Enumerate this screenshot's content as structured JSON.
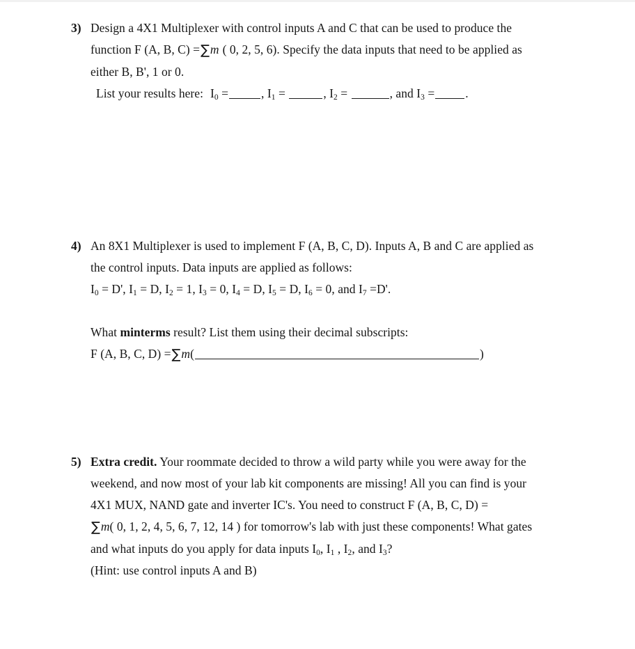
{
  "document": {
    "type": "homework-worksheet",
    "subject": "Digital Logic - Multiplexers",
    "background_color": "#ffffff",
    "text_color": "#161616"
  },
  "questions": [
    {
      "number": "3)",
      "name": "question-3",
      "lines": [
        {
          "id": "q3-l1",
          "text": "Design a 4X1 Multiplexer with control inputs A and C that can be used to produce the"
        },
        {
          "id": "q3-l2",
          "text_before_sigma": "function F (A, B, C) =",
          "sigma": "∑",
          "m": "m",
          "text_after_sigma": "( 0, 2, 5, 6).  Specify the data inputs that need to be applied as"
        },
        {
          "id": "q3-l3",
          "text": "either B, B', 1 or 0."
        },
        {
          "id": "q3-l4",
          "prompt": "List your results here:",
          "i0_label": "I",
          "i0_sub": "0",
          "eq": "=",
          "sep1": ",",
          "i1_label": "I",
          "i1_sub": "1",
          "sep2": ",",
          "i2_label": "I",
          "i2_sub": "2",
          "sep3": ", and",
          "i3_label": "I",
          "i3_sub": "3",
          "period": "."
        }
      ]
    },
    {
      "number": "4)",
      "name": "question-4",
      "lines": [
        {
          "id": "q4-l1",
          "text": "An 8X1 Multiplexer is used to implement F (A, B, C, D).  Inputs A, B and C are applied as"
        },
        {
          "id": "q4-l2",
          "text": "the control inputs.  Data inputs are applied as follows:"
        },
        {
          "id": "q4-l3",
          "assignments": [
            {
              "label": "I",
              "sub": "0",
              "value": "D'"
            },
            {
              "label": "I",
              "sub": "1",
              "value": "D"
            },
            {
              "label": "I",
              "sub": "2",
              "value": "1"
            },
            {
              "label": "I",
              "sub": "3",
              "value": "0"
            },
            {
              "label": "I",
              "sub": "4",
              "value": "D"
            },
            {
              "label": "I",
              "sub": "5",
              "value": "D"
            },
            {
              "label": "I",
              "sub": "6",
              "value": "0"
            },
            {
              "label": "I",
              "sub": "7",
              "value": "D'"
            }
          ],
          "and_text": "and",
          "trailing": "."
        },
        {
          "id": "q4-l4",
          "text_before_bold": "What ",
          "bold_text": "minterms",
          "text_after_bold": " result?  List them using their decimal subscripts:"
        },
        {
          "id": "q4-l5",
          "prefix": "F (A, B, C, D) =",
          "sigma": "∑",
          "m": "m",
          "open_paren": "(",
          "close_paren": ")"
        }
      ]
    },
    {
      "number": "5)",
      "name": "question-5",
      "lines": [
        {
          "id": "q5-l1",
          "bold_text": "Extra credit.",
          "text": "  Your roommate decided to throw a wild party while you were away for the"
        },
        {
          "id": "q5-l2",
          "text": "weekend, and now most of your lab kit components are missing!  All you can find is your"
        },
        {
          "id": "q5-l3",
          "text": "4X1 MUX, NAND gate and inverter IC's.  You need to construct F (A, B, C, D) ="
        },
        {
          "id": "q5-l4",
          "sigma": "∑",
          "m": "m",
          "minterms": "( 0, 1, 2, 4, 5, 6, 7, 12, 14 )",
          "text_after": "for tomorrow's lab with just these components!  What gates"
        },
        {
          "id": "q5-l5",
          "prefix": "and what inputs do you apply for data inputs",
          "i0_label": "I",
          "i0_sub": "0",
          "sep1": ",",
          "i1_label": "I",
          "i1_sub": "1",
          "sep2": ",",
          "i2_label": "I",
          "i2_sub": "2",
          "sep3": "and",
          "i3_label": "I",
          "i3_sub": "3",
          "question_mark": "?"
        },
        {
          "id": "q5-l6",
          "text": "(Hint: use control inputs A and B)"
        }
      ]
    }
  ]
}
